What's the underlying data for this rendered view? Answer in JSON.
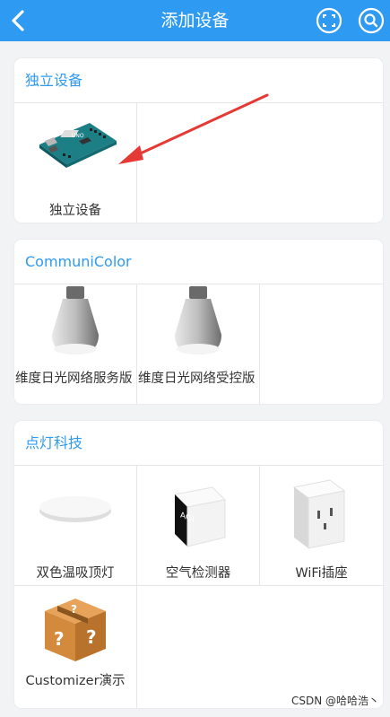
{
  "header": {
    "title": "添加设备",
    "background": "#2f9af2"
  },
  "sections": [
    {
      "title": "独立设备",
      "items": [
        {
          "label": "独立设备",
          "icon": "arduino-board-icon"
        }
      ]
    },
    {
      "title": "CommuniColor",
      "items": [
        {
          "label": "维度日光网络服务版",
          "icon": "light-bulb-icon"
        },
        {
          "label": "维度日光网络受控版",
          "icon": "light-bulb-icon"
        }
      ]
    },
    {
      "title": "点灯科技",
      "items": [
        {
          "label": "双色温吸顶灯",
          "icon": "ceiling-lamp-icon"
        },
        {
          "label": "空气检测器",
          "icon": "aqi-monitor-icon",
          "screen_text": "AQI"
        },
        {
          "label": "WiFi插座",
          "icon": "wifi-socket-icon"
        },
        {
          "label": "Customizer演示",
          "icon": "mystery-box-icon"
        }
      ]
    }
  ],
  "watermark": "CSDN @哈哈浩丶"
}
